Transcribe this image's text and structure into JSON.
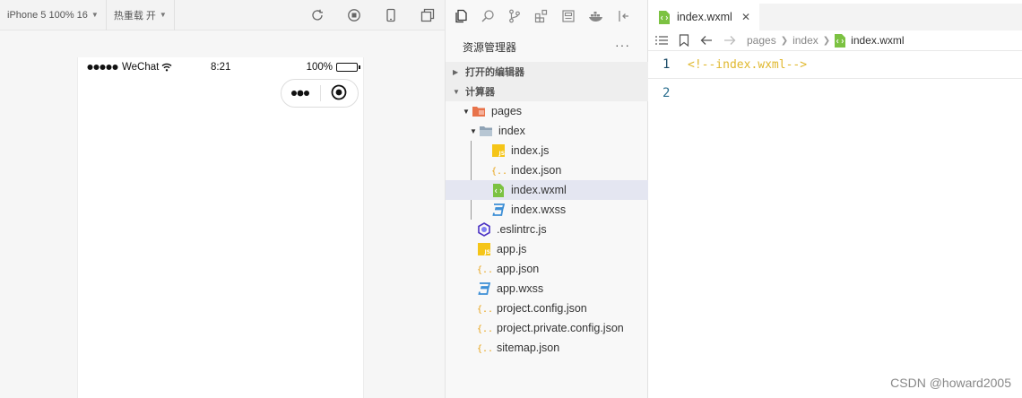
{
  "simulator": {
    "device_select": "iPhone 5 100% 16",
    "hot_reload_select": "热重载 开",
    "toolbar_icons": [
      "refresh-icon",
      "stop-icon",
      "phone-icon",
      "window-icon"
    ],
    "status_bar": {
      "carrier": "WeChat",
      "time": "8:21",
      "battery": "100%",
      "battery_level": 1.0
    }
  },
  "explorer": {
    "activity_icons": [
      "files-icon",
      "search-icon",
      "source-control-icon",
      "extensions-icon",
      "layout-icon",
      "docker-icon",
      "panel-icon"
    ],
    "header_title": "资源管理器",
    "more_label": "···",
    "sections": {
      "open_editors": "打开的编辑器",
      "workspace": "计算器"
    },
    "tree": [
      {
        "label": "pages",
        "type": "folder-open",
        "icon": "folder-pages-icon"
      },
      {
        "label": "index",
        "type": "folder-open",
        "icon": "folder-icon"
      },
      {
        "label": "index.js",
        "type": "file",
        "icon": "js-file-icon"
      },
      {
        "label": "index.json",
        "type": "file",
        "icon": "json-file-icon"
      },
      {
        "label": "index.wxml",
        "type": "file",
        "icon": "wxml-file-icon",
        "selected": true
      },
      {
        "label": "index.wxss",
        "type": "file",
        "icon": "css-file-icon"
      },
      {
        "label": ".eslintrc.js",
        "type": "file",
        "icon": "eslint-file-icon"
      },
      {
        "label": "app.js",
        "type": "file",
        "icon": "js-file-icon"
      },
      {
        "label": "app.json",
        "type": "file",
        "icon": "json-file-icon"
      },
      {
        "label": "app.wxss",
        "type": "file",
        "icon": "css-file-icon"
      },
      {
        "label": "project.config.json",
        "type": "file",
        "icon": "json-file-icon"
      },
      {
        "label": "project.private.config.json",
        "type": "file",
        "icon": "json-file-icon"
      },
      {
        "label": "sitemap.json",
        "type": "file",
        "icon": "json-file-icon"
      }
    ]
  },
  "editor": {
    "tab": {
      "label": "index.wxml",
      "close": "✕"
    },
    "breadcrumb": [
      "pages",
      "index",
      "index.wxml"
    ],
    "lines": [
      {
        "number": "1",
        "text": "<!--index.wxml-->"
      },
      {
        "number": "2",
        "text": ""
      }
    ]
  },
  "watermark": "CSDN @howard2005",
  "colors": {
    "js_icon": "#f5c518",
    "json_icon": "#e8a317",
    "wxml_icon": "#7cc242",
    "css_icon": "#3d8fd6",
    "eslint_icon": "#4b32c3",
    "folder_pages": "#e8734a",
    "comment": "#e0b82e",
    "code_green": "#a3c93a",
    "selection": "#e4e6f1"
  }
}
